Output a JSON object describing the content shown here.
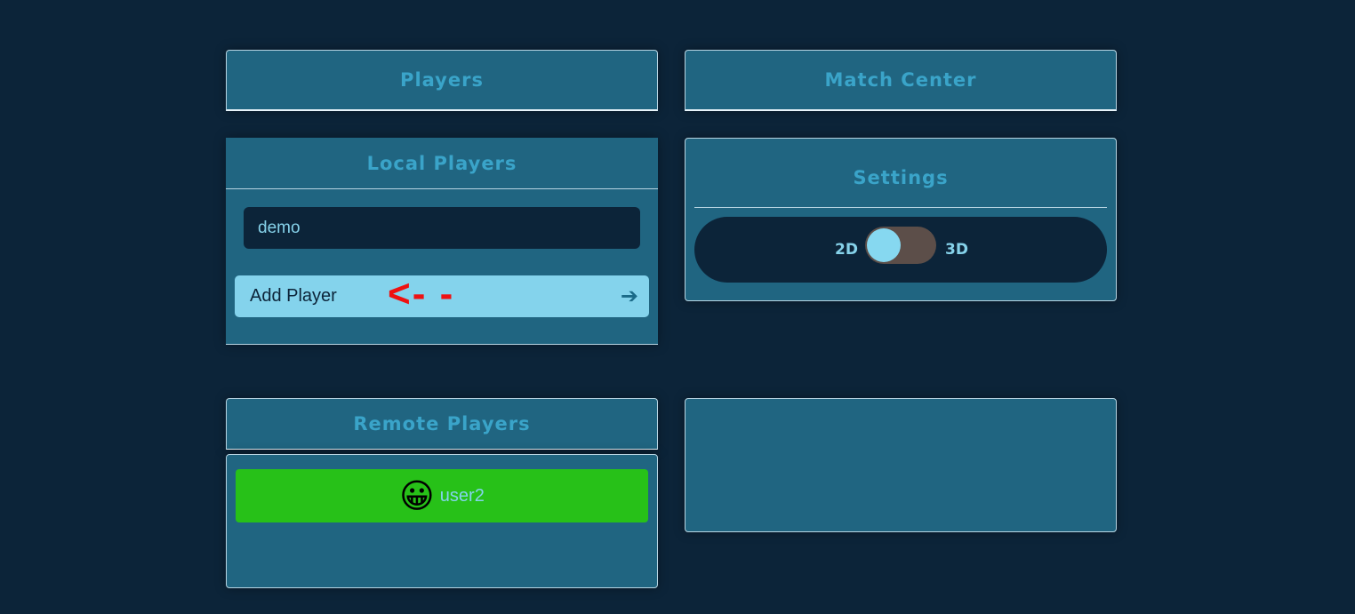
{
  "tabs": {
    "players": "Players",
    "match_center": "Match Center"
  },
  "local_players": {
    "title": "Local Players",
    "input_value": "demo",
    "add_button_label": "Add Player",
    "add_button_icon": "arrow-right-icon",
    "annotation": "<- -"
  },
  "settings": {
    "title": "Settings",
    "toggle_left_label": "2D",
    "toggle_right_label": "3D",
    "toggle_state": "2D"
  },
  "remote_players": {
    "title": "Remote Players",
    "items": [
      {
        "avatar": "😀",
        "name": "user2",
        "status_color": "#27c118"
      }
    ]
  },
  "colors": {
    "background": "#0c2439",
    "panel": "#206581",
    "title_text": "#3aa4c9",
    "button": "#84d3ec",
    "annotation": "#ee1111"
  }
}
